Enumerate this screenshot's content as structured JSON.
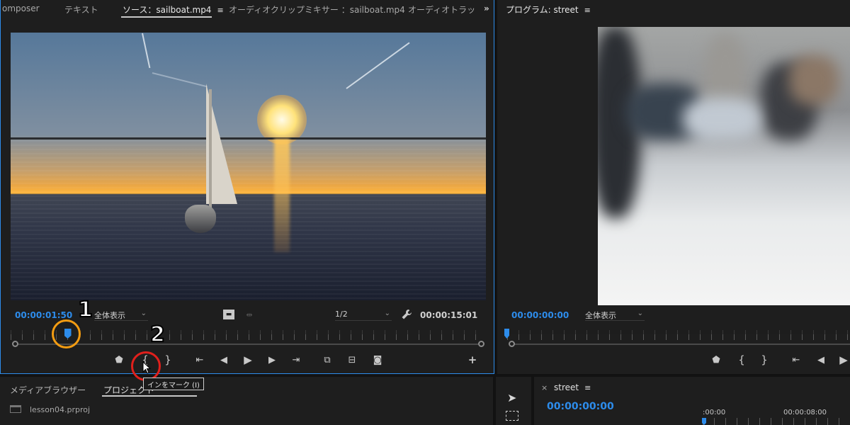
{
  "source": {
    "tabs": [
      {
        "label": "omposer",
        "active": false
      },
      {
        "label": "テキスト",
        "active": false
      },
      {
        "label": "ソース：sailboat.mp4",
        "active": true
      },
      {
        "label": "オーディオクリップミキサー ：sailboat.mp4",
        "active": false
      },
      {
        "label": "オーディオトラッ",
        "active": false
      }
    ],
    "overflow_label": "»",
    "timecode_in": "00:00:01:50",
    "zoom_label": "全体表示",
    "resolution_label": "1/2",
    "timecode_duration": "00:00:15:01",
    "playhead_fraction": 0.12
  },
  "program": {
    "tab_label": "プログラム: street",
    "timecode": "00:00:00:00",
    "zoom_label": "全体表示",
    "playhead_fraction": 0.0
  },
  "annotations": {
    "callout_1": "1",
    "callout_2": "2",
    "callout_1_color": "#f39c12",
    "callout_2_color": "#e0201c",
    "tooltip": "インをマーク (I)"
  },
  "project": {
    "tabs": [
      {
        "label": "メディアブラウザー",
        "active": false
      },
      {
        "label": "プロジェクト",
        "active": true
      }
    ],
    "file": "lesson04.prproj"
  },
  "timeline": {
    "tab_label": "street",
    "timecode": "00:00:00:00",
    "ruler_labels": [
      ":00:00",
      "00:00:08:00"
    ]
  },
  "icons": {
    "menu": "≡",
    "dropdown": "⌄",
    "wrench": "wrench-icon",
    "close": "×"
  },
  "colors": {
    "accent": "#2d8ceb",
    "panel_bg": "#1e1e1e",
    "app_bg": "#121212"
  }
}
